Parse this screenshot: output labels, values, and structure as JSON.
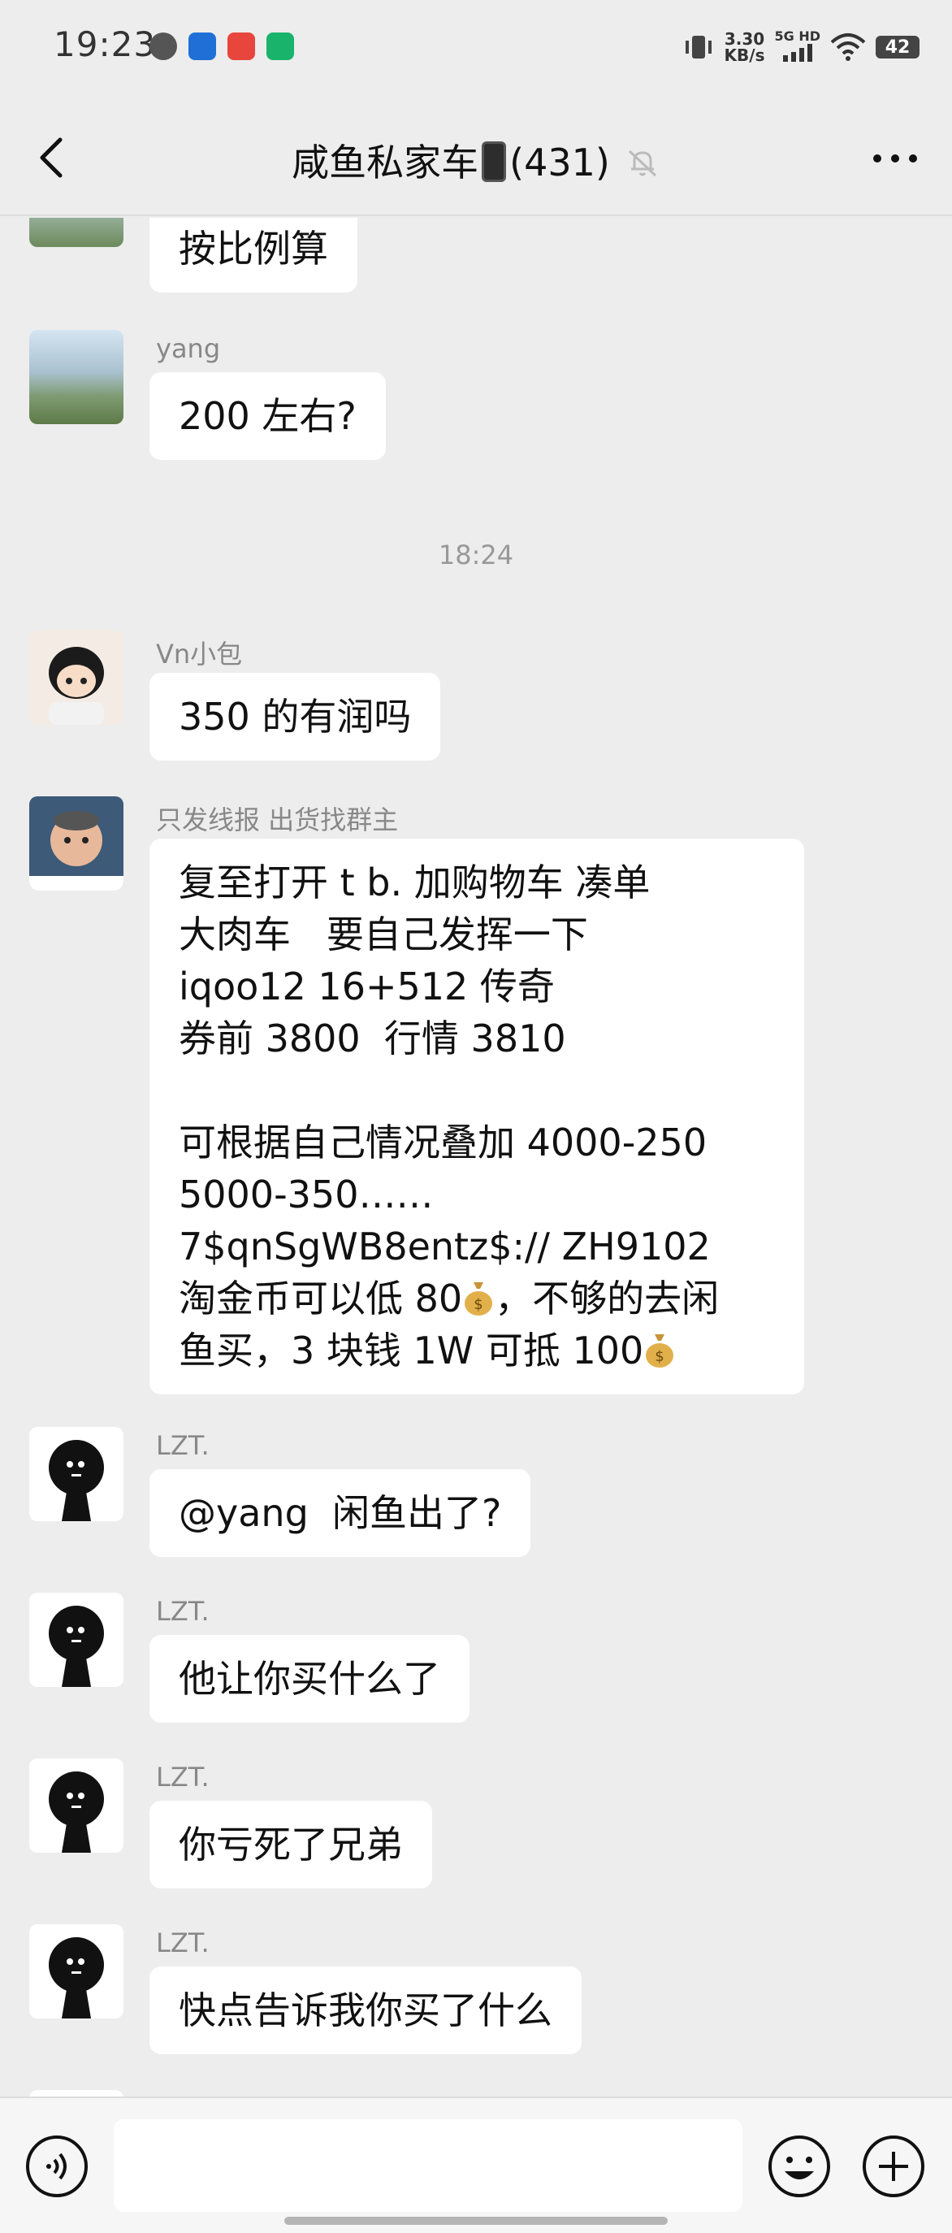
{
  "status_bar": {
    "time": "19:23",
    "net_speed_value": "3.30",
    "net_speed_unit": "KB/s",
    "network": "5G HD",
    "battery": "42"
  },
  "header": {
    "title_prefix": "咸鱼私家车",
    "title_count": "(431)",
    "icons": [
      "back-icon",
      "phone-emoji",
      "mute-bell-icon",
      "more-icon"
    ]
  },
  "messages": [
    {
      "sender": "",
      "text": "按比例算"
    },
    {
      "sender": "yang",
      "text": "200 左右?"
    },
    {
      "timestamp": "18:24"
    },
    {
      "sender": "Vn小包",
      "text": "350 的有润吗"
    },
    {
      "sender": "只发线报 出货找群主",
      "lines": [
        "复至打开 t b. 加购物车 凑单",
        "大肉车   要自己发挥一下",
        "iqoo12 16+512 传奇",
        "券前 3800  行情 3810",
        "",
        "可根据自己情况叠加 4000-250",
        "5000-350……",
        "7$qnSgWB8entz$:// ZH9102",
        "淘金币可以低 80",
        "，不够的去闲",
        "鱼买，3 块钱 1W 可抵 100"
      ]
    },
    {
      "sender": "LZT.",
      "text": "@yang  闲鱼出了?"
    },
    {
      "sender": "LZT.",
      "text": "他让你买什么了"
    },
    {
      "sender": "LZT.",
      "text": "你亏死了兄弟"
    },
    {
      "sender": "LZT.",
      "text": "快点告诉我你买了什么"
    }
  ],
  "input_bar": {
    "placeholder": "",
    "icons": [
      "voice-icon",
      "emoji-icon",
      "plus-icon"
    ]
  },
  "colors": {
    "background": "#ededed",
    "bubble": "#ffffff",
    "sender_text": "#888888"
  }
}
